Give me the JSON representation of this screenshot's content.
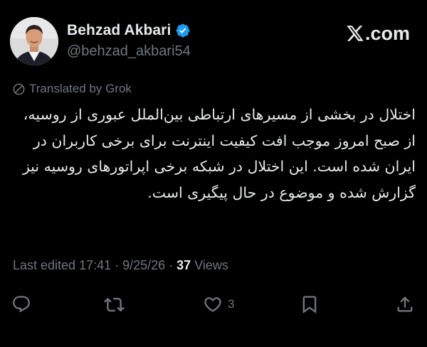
{
  "author": {
    "display_name": "Behzad Akbari",
    "handle": "@behzad_akbari54",
    "verified": true,
    "avatar_icon": "profile-photo"
  },
  "brand": {
    "label": ".com",
    "icon": "x-logo-icon"
  },
  "translation": {
    "label": "Translated by Grok",
    "icon": "grok-icon"
  },
  "tweet": {
    "text": "اختلال در بخشی از مسیرهای ارتباطی بین‌الملل عبوری از روسیه، از صبح امروز موجب افت کیفیت اینترنت برای برخی کاربران در ایران شده است. این اختلال در شبکه برخی اپراتورهای روسیه نیز گزارش شده و موضوع در حال پیگیری است."
  },
  "meta": {
    "edited_label": "Last edited 17:41 · 9/25/26",
    "separator": "·",
    "views_count": "37",
    "views_label": "Views"
  },
  "actions": {
    "reply": {
      "icon": "reply-icon",
      "count": ""
    },
    "repost": {
      "icon": "repost-icon",
      "count": ""
    },
    "like": {
      "icon": "heart-icon",
      "count": "3"
    },
    "bookmark": {
      "icon": "bookmark-icon",
      "count": ""
    },
    "share": {
      "icon": "share-icon",
      "count": ""
    }
  },
  "colors": {
    "background": "#000000",
    "primary_text": "#e7e9ea",
    "secondary_text": "#71767b",
    "verified_badge": "#1d9bf0"
  }
}
